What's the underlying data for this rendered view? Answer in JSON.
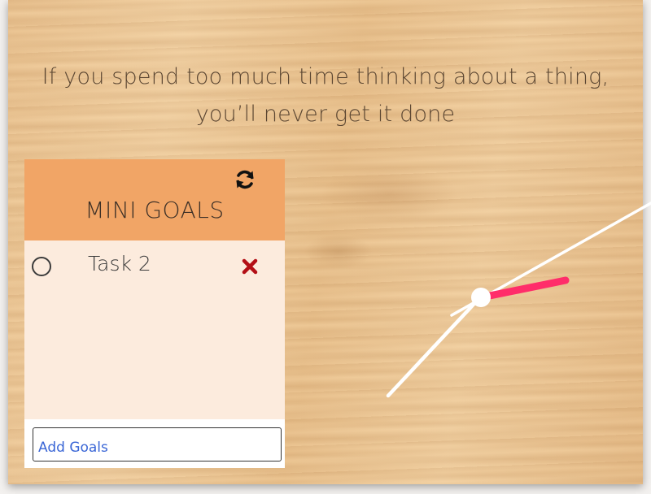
{
  "quote": {
    "line1": "If you spend too much time thinking about a thing,",
    "line2": "you’ll never get it done"
  },
  "goals_panel": {
    "title": "MINI GOALS",
    "refresh_icon": "refresh-icon",
    "tasks": [
      {
        "label": "Task 2",
        "completed": false,
        "check_icon": "circle-icon",
        "delete_icon": "close-icon"
      }
    ],
    "add_input": {
      "placeholder": "Add Goals",
      "value": ""
    }
  },
  "clock": {
    "hand_colors": {
      "hour": "#ff2d6a",
      "minute": "#ffffff",
      "second": "#ffffff",
      "center": "#ffffff"
    }
  },
  "colors": {
    "header": "#f1a566",
    "panel_bg": "#fcebdd",
    "delete": "#b30f16",
    "placeholder": "#3a66d6"
  }
}
